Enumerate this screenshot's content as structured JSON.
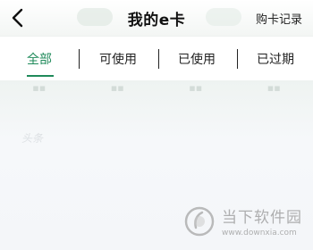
{
  "header": {
    "title": "我的e卡",
    "purchase_record": "购卡记录"
  },
  "tabs": [
    {
      "label": "全部",
      "active": true
    },
    {
      "label": "可使用",
      "active": false
    },
    {
      "label": "已使用",
      "active": false
    },
    {
      "label": "已过期",
      "active": false
    }
  ],
  "colors": {
    "accent": "#1f8a5a"
  },
  "background": {
    "faded_label": "头条"
  },
  "watermark": {
    "brand": "当下软件园",
    "url": "www.downxia.com"
  }
}
